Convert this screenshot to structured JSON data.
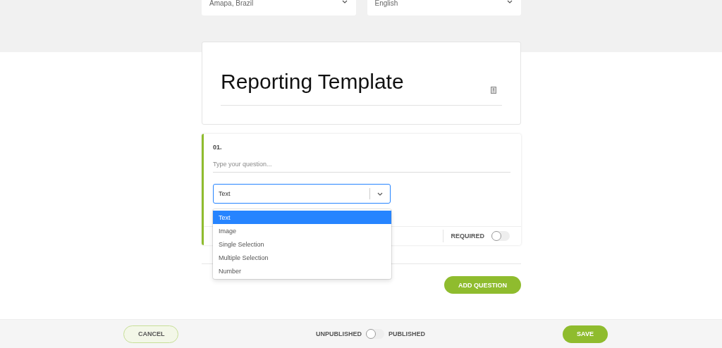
{
  "filters": [
    {
      "value": "Amapa, Brazil"
    },
    {
      "value": "English"
    }
  ],
  "template": {
    "title": "Reporting Template"
  },
  "question": {
    "number": "01.",
    "placeholder": "Type your question...",
    "type_value": "Text",
    "open": true,
    "options": [
      {
        "label": "Text",
        "selected": true
      },
      {
        "label": "Image",
        "selected": false
      },
      {
        "label": "Single Selection",
        "selected": false
      },
      {
        "label": "Multiple Selection",
        "selected": false
      },
      {
        "label": "Number",
        "selected": false
      }
    ],
    "required_label": "REQUIRED",
    "required": false
  },
  "add_button": "ADD QUESTION",
  "footer": {
    "cancel": "CANCEL",
    "unpublished_label": "UNPUBLISHED",
    "published_label": "PUBLISHED",
    "published": false,
    "save": "SAVE"
  }
}
